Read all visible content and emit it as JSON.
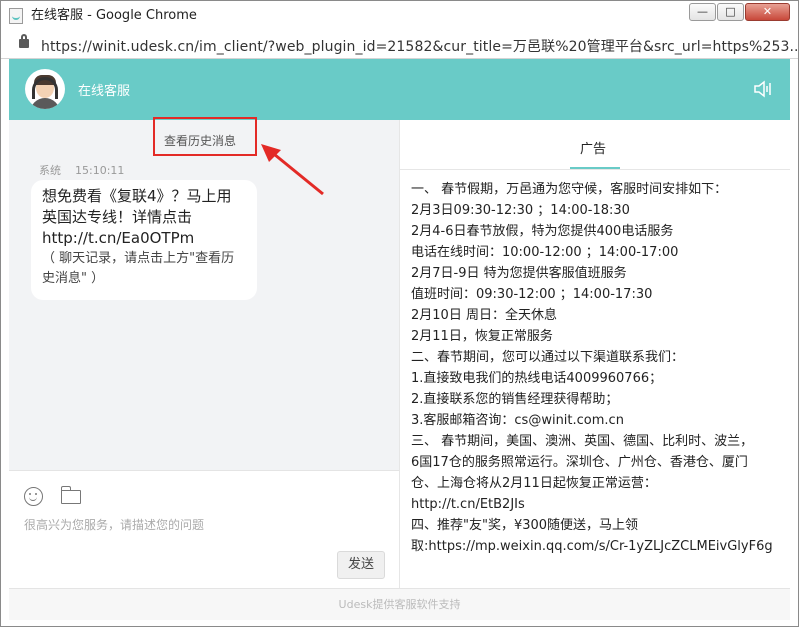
{
  "window": {
    "title": "在线客服 - Google Chrome",
    "url": "https://winit.udesk.cn/im_client/?web_plugin_id=21582&cur_title=万邑联%20管理平台&src_url=https%253..."
  },
  "header": {
    "title": "在线客服"
  },
  "chat": {
    "history_link": "查看历史消息",
    "message": {
      "sender": "系统",
      "time": "15:10:11",
      "lines": [
        "想免费看《复联4》？马上用",
        "英国达专线！详情点击",
        "http://t.cn/Ea0OTPm"
      ],
      "note_lines": [
        "（ 聊天记录，请点击上方\"查看历",
        "史消息\" ）"
      ]
    }
  },
  "input": {
    "placeholder": "很高兴为您服务，请描述您的问题",
    "send_label": "发送"
  },
  "ad": {
    "tab_label": "广告",
    "lines": [
      "一、 春节假期，万邑通为您守候，客服时间安排如下：",
      "2月3日09:30-12:30 ；14:00-18:30",
      "2月4-6日春节放假，特为您提供400电话服务",
      "电话在线时间：10:00-12:00 ；14:00-17:00",
      "2月7日-9日 特为您提供客服值班服务",
      "值班时间：09:30-12:00 ；14:00-17:30",
      "2月10日 周日：全天休息",
      "2月11日，恢复正常服务",
      "二、春节期间，您可以通过以下渠道联系我们：",
      "1.直接致电我们的热线电话4009960766；",
      "2.直接联系您的销售经理获得帮助；",
      "3.客服邮箱咨询：cs@winit.com.cn",
      "三、 春节期间，美国、澳洲、英国、德国、比利时、波兰，",
      "6国17仓的服务照常运行。深圳仓、广州仓、香港仓、厦门",
      "仓、上海仓将从2月11日起恢复正常运营：",
      "http://t.cn/EtB2JIs",
      "四、推荐\"友\"奖，¥300随便送，马上领",
      "取:https://mp.weixin.qq.com/s/Cr-1yZLJcZCLMEivGlyF6g"
    ]
  },
  "footer": {
    "text": "Udesk提供客服软件支持"
  },
  "colors": {
    "accent": "#69cbc7",
    "annotation": "#e32a26"
  }
}
